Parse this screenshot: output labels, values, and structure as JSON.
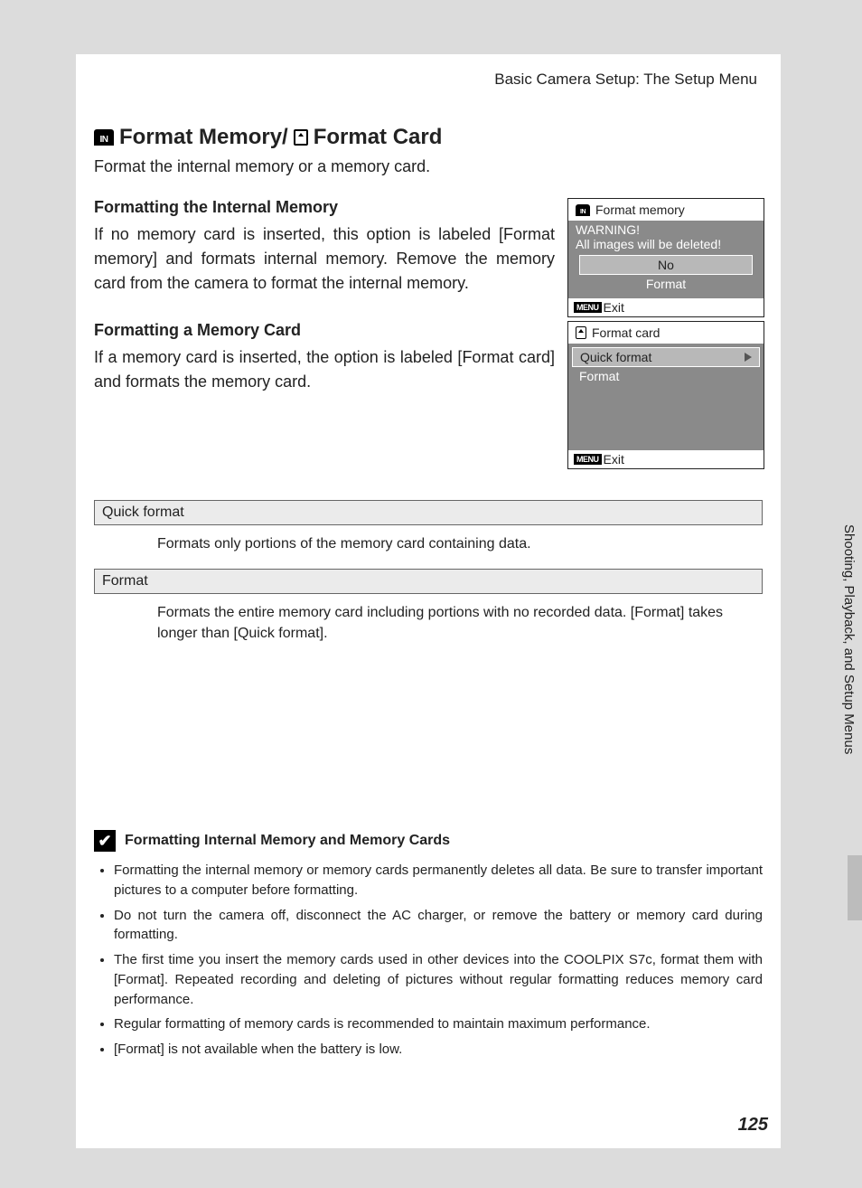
{
  "header": "Basic Camera Setup: The Setup Menu",
  "title_part1": "Format Memory/",
  "title_part2": "Format Card",
  "intro": "Format the internal memory or a memory card.",
  "section1": {
    "heading": "Formatting the Internal Memory",
    "body": "If no memory card is inserted, this option is labeled [Format memory] and formats internal memory. Remove the memory card from the camera to format the internal memory."
  },
  "section2": {
    "heading": "Formatting a Memory Card",
    "body": "If a memory card is inserted, the option is labeled [Format card] and formats the memory card."
  },
  "lcd1": {
    "title": "Format memory",
    "warn1": "WARNING!",
    "warn2": "All images will be deleted!",
    "opt_no": "No",
    "opt_format": "Format",
    "exit": "Exit"
  },
  "lcd2": {
    "title": "Format card",
    "opt1": "Quick format",
    "opt2": "Format",
    "exit": "Exit"
  },
  "menu_label": "MENU",
  "defs": {
    "quick_h": "Quick format",
    "quick_d": "Formats only portions of the memory card containing data.",
    "format_h": "Format",
    "format_d": "Formats the entire memory card including portions with no recorded data. [Format] takes longer than [Quick format]."
  },
  "note": {
    "heading": "Formatting Internal Memory and Memory Cards",
    "items": [
      "Formatting the internal memory or memory cards permanently deletes all data. Be sure to transfer important pictures to a computer before formatting.",
      "Do not turn the camera off, disconnect the AC charger, or remove the battery or memory card during formatting.",
      "The first time you insert the memory cards used in other devices into the COOLPIX S7c, format them with [Format]. Repeated recording and deleting of pictures without regular formatting reduces memory card performance.",
      "Regular formatting of memory cards is recommended to maintain maximum performance.",
      "[Format] is not available when the battery is low."
    ]
  },
  "side_tab": "Shooting, Playback, and Setup Menus",
  "page_number": "125"
}
